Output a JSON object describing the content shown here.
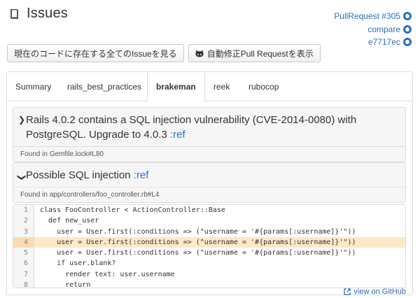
{
  "header": {
    "title": "Issues",
    "icon": "book-icon"
  },
  "links": [
    {
      "label": "PullRequest #305",
      "icon": "github-icon"
    },
    {
      "label": "compare",
      "icon": "github-icon"
    },
    {
      "label": "e7717ec",
      "icon": "github-icon"
    }
  ],
  "buttons": {
    "all_issues": "現在のコードに存在する全てのIssueを見る",
    "auto_fix": "自動修正Pull Requestを表示"
  },
  "tabs": [
    "Summary",
    "rails_best_practices",
    "brakeman",
    "reek",
    "rubocop"
  ],
  "active_tab": "brakeman",
  "issues": [
    {
      "title": "Rails 4.0.2 contains a SQL injection vulnerability (CVE-2014-0080) with PostgreSQL. Upgrade to 4.0.3",
      "ref": ":ref",
      "location": "Found in Gemfile.lock#L80",
      "expanded": false
    },
    {
      "title": "Possible SQL injection",
      "ref": ":ref",
      "location": "Found in app/controllers/foo_controller.rb#L4",
      "expanded": true
    }
  ],
  "code": {
    "highlighted_line": 4,
    "lines": [
      {
        "n": "1",
        "text": "class FooController < ActionController::Base"
      },
      {
        "n": "2",
        "text": "  def new_user"
      },
      {
        "n": "3",
        "text": "    user = User.first(:conditions => (\"username = '#{params[:username]}'\"))"
      },
      {
        "n": "4",
        "text": "    user = User.first(:conditions => (\"username = '#{params[:username]}'\"))"
      },
      {
        "n": "5",
        "text": "    user = User.first(:conditions => (\"username = '#{params[:username]}'\"))"
      },
      {
        "n": "6",
        "text": "    if user.blank?"
      },
      {
        "n": "7",
        "text": "      render text: user.username"
      },
      {
        "n": "8",
        "text": "      return"
      }
    ]
  },
  "view_on_github": "view on GitHub",
  "colors": {
    "link": "#2a6fc2",
    "highlight": "#fde8c8"
  }
}
